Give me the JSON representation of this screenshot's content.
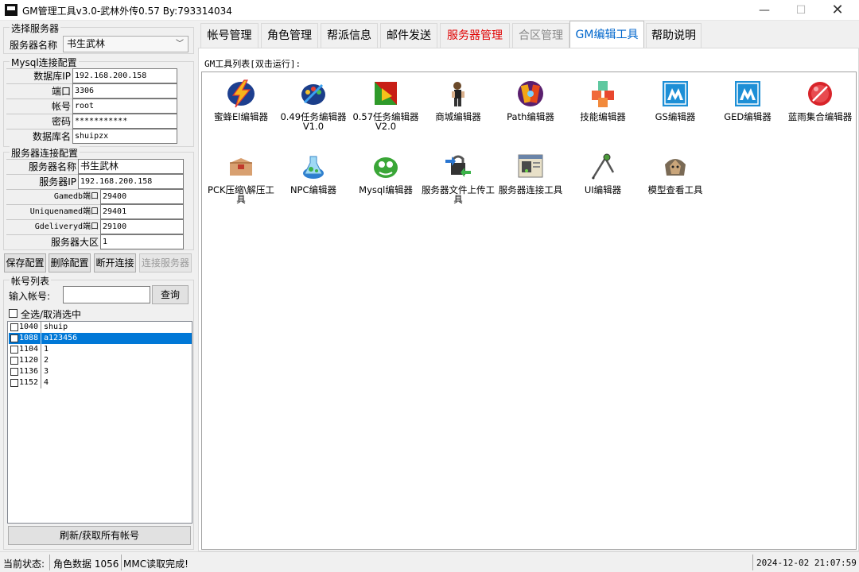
{
  "window": {
    "title": "GM管理工具v3.0-武林外传0.57 By:793314034",
    "min_glyph": "—",
    "max_glyph": "☐",
    "close_glyph": "✕"
  },
  "select_server": {
    "group_title": "选择服务器",
    "label": "服务器名称",
    "value": "书生武林"
  },
  "mysql": {
    "group_title": "Mysql连接配置",
    "fields": [
      {
        "label": "数据库IP",
        "value": "192.168.200.158"
      },
      {
        "label": "端口",
        "value": "3306"
      },
      {
        "label": "帐号",
        "value": "root"
      },
      {
        "label": "密码",
        "value": "***********"
      },
      {
        "label": "数据库名",
        "value": "shuipzx"
      }
    ]
  },
  "server_conn": {
    "group_title": "服务器连接配置",
    "fields": [
      {
        "label": "服务器名称",
        "value": "书生武林"
      },
      {
        "label": "服务器IP",
        "value": "192.168.200.158"
      },
      {
        "label": "Gamedb端口",
        "value": "29400"
      },
      {
        "label": "Uniquenamed端口",
        "value": "29401"
      },
      {
        "label": "Gdeliveryd端口",
        "value": "29100"
      },
      {
        "label": "服务器大区",
        "value": "1"
      }
    ]
  },
  "config_buttons": {
    "save": "保存配置",
    "delete": "删除配置",
    "disconnect": "断开连接",
    "connect": "连接服务器"
  },
  "accounts": {
    "group_title": "帐号列表",
    "input_label": "输入帐号:",
    "input_value": "",
    "query_button": "查询",
    "select_all": "全选/取消选中",
    "rows": [
      {
        "id": "1040",
        "name": "shuip",
        "selected": false
      },
      {
        "id": "1088",
        "name": "a123456",
        "selected": true
      },
      {
        "id": "1104",
        "name": "1",
        "selected": false
      },
      {
        "id": "1120",
        "name": "2",
        "selected": false
      },
      {
        "id": "1136",
        "name": "3",
        "selected": false
      },
      {
        "id": "1152",
        "name": "4",
        "selected": false
      }
    ],
    "refresh_button": "刷新/获取所有帐号"
  },
  "tabs": [
    {
      "label": "帐号管理",
      "state": "normal"
    },
    {
      "label": "角色管理",
      "state": "normal"
    },
    {
      "label": "帮派信息",
      "state": "normal"
    },
    {
      "label": "邮件发送",
      "state": "normal"
    },
    {
      "label": "服务器管理",
      "state": "red"
    },
    {
      "label": "合区管理",
      "state": "disabled"
    },
    {
      "label": "GM编辑工具",
      "state": "active"
    },
    {
      "label": "帮助说明",
      "state": "normal"
    }
  ],
  "tools_caption": "GM工具列表[双击运行]:",
  "tools": [
    {
      "label": "蜜蜂El编辑器",
      "icon": "lightning-bolt-icon"
    },
    {
      "label": "0.49任务编辑器V1.0",
      "icon": "palette-icon"
    },
    {
      "label": "0.57任务编辑器V2.0",
      "icon": "gradient-square-icon"
    },
    {
      "label": "商城编辑器",
      "icon": "character-figure-icon"
    },
    {
      "label": "Path编辑器",
      "icon": "game-logo-icon"
    },
    {
      "label": "技能编辑器",
      "icon": "cubes-icon"
    },
    {
      "label": "GS编辑器",
      "icon": "blue-m-icon"
    },
    {
      "label": "GED编辑器",
      "icon": "blue-m-icon"
    },
    {
      "label": "蓝雨集合编辑器",
      "icon": "red-orb-icon"
    },
    {
      "label": "PCK压缩\\解压工具",
      "icon": "package-box-icon"
    },
    {
      "label": "NPC编辑器",
      "icon": "flask-icon"
    },
    {
      "label": "Mysql编辑器",
      "icon": "green-blob-icon"
    },
    {
      "label": "服务器文件上传工具",
      "icon": "lock-transfer-icon"
    },
    {
      "label": "服务器连接工具",
      "icon": "server-window-icon"
    },
    {
      "label": "UI编辑器",
      "icon": "compass-icon"
    },
    {
      "label": "模型查看工具",
      "icon": "model-head-icon"
    }
  ],
  "status": {
    "state_label": "当前状态:",
    "role_data": "角色数据 1056",
    "message": "MMC读取完成!",
    "datetime": "2024-12-02  21:07:59"
  }
}
